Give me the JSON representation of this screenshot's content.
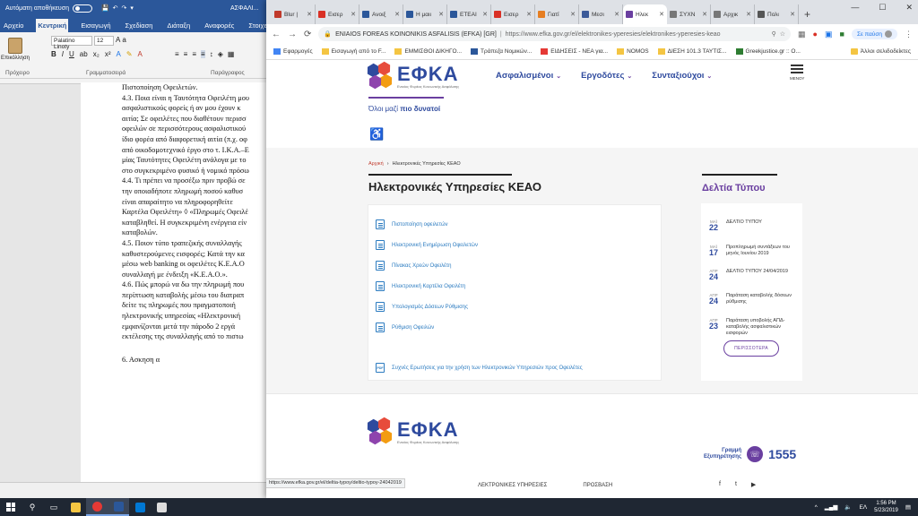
{
  "word": {
    "autosave_label": "Αυτόματη αποθήκευση",
    "doc_title": "ΑΣΦΑΛΙ...",
    "tabs": [
      "Αρχείο",
      "Κεντρική",
      "Εισαγωγή",
      "Σχεδίαση",
      "Διάταξη",
      "Αναφορές",
      "Στοιχεία αλληλ"
    ],
    "font_name": "Palatino Linoty",
    "font_size": "12",
    "paste_label": "Επικόλληση",
    "groups": [
      "Πρόχειρο",
      "Γραμματοσειρά",
      "Παράγραφος"
    ],
    "lines": [
      "Πιστοποίηση Οφειλετών.",
      "4.3. Ποια είναι η Ταυτότητα Οφειλέτη μου",
      "ασφαλιστικούς φορείς ή αν μου έχουν κ",
      "αιτία; Σε οφειλέτες που διαθέτουν περισσ",
      "οφειλών σε περισσότερους ασφαλιστικού",
      "ίδιο φορέα από διαφορετική αιτία (π.χ. οφ",
      "από οικοδομοτεχνικό έργο στο τ. Ι.Κ.Α.–Ε",
      "μίας Ταυτότητες Οφειλέτη ανάλογα με το",
      "στο συγκεκριμένο φυσικό ή νομικό πρόσω",
      "4.4. Τι πρέπει να προσέξω πριν προβώ σε",
      "την οποιαδήποτε πληρωμή ποσού καθυσ",
      "είναι απαραίτητο να πληροφορηθείτε",
      "Καρτέλα Οφειλέτη» ◊ «Πληρωμές Οφειλέ",
      "καταβληθεί. Η συγκεκριμένη ενέργεια είν",
      "καταβολών.",
      " 4.5. Ποιον τύπο τραπεζικής συναλλαγής",
      "καθυστερούμενες εισφορές; Κατά την κα",
      "μέσω web banking οι οφειλέτες Κ.Ε.Α.Ο",
      "συναλλαγή με ένδειξη «Κ.Ε.Α.Ο.».",
      "4.6. Πώς μπορώ να δω την πληρωμή που",
      "περίπτωση καταβολής μέσω του διατραπ",
      "δείτε τις πληρωμές που πραγματοποιή",
      "ηλεκτρονικής υπηρεσίας «Ηλεκτρονική",
      "εμφανίζονται μετά την πάροδο 2 εργά",
      "εκτέλεσης της συναλλαγής από το πιστω",
      "",
      "                          6. Ασκηση α"
    ]
  },
  "chrome": {
    "tabs": [
      {
        "label": "Blur |",
        "color": "#c0392b"
      },
      {
        "label": "Εισερ",
        "color": "#d93025"
      },
      {
        "label": "Ανοιξ",
        "color": "#2b579a"
      },
      {
        "label": "Η μαιι",
        "color": "#2b579a"
      },
      {
        "label": "ΕΤΕΑΙ",
        "color": "#2b579a"
      },
      {
        "label": "Εισερ",
        "color": "#d93025"
      },
      {
        "label": "Γιατί",
        "color": "#e67e22"
      },
      {
        "label": "Μεσι",
        "color": "#3b5998"
      },
      {
        "label": "Ηλεκ",
        "color": "#6a3fa0"
      },
      {
        "label": "ΣΥΧΝ",
        "color": "#777777"
      },
      {
        "label": "Αρχικ",
        "color": "#777777"
      },
      {
        "label": "Πολι",
        "color": "#555555"
      }
    ],
    "site_name": "ENIAIOS FOREAS KOINONIKIS ASFALISIS (EFKA) [GR]",
    "url": "https://www.efka.gov.gr/el/elektronikes-yperesies/elektronikes-yperesies-keao",
    "profile_label": "Σε παύση",
    "bookmarks": [
      {
        "label": "Εφαρμογές",
        "color": "#4285f4"
      },
      {
        "label": "Εισαγωγή από το F...",
        "color": "#f4c542"
      },
      {
        "label": "ΕΜΜΙΣΘΟΙ ΔΙΚΗΓΟ...",
        "color": "#f4c542"
      },
      {
        "label": "Τράπεζα Νομικών...",
        "color": "#2b579a"
      },
      {
        "label": "ΕΙΔΗΣΕΙΣ - ΝΕΑ για...",
        "color": "#e53935"
      },
      {
        "label": "NOMOS",
        "color": "#f4c542"
      },
      {
        "label": "ΔΙΕΣΗ 101.3 ΤΑΥΤΙΣ...",
        "color": "#f4c542"
      },
      {
        "label": "Greekjustice.gr :: Ο...",
        "color": "#2e7d32"
      }
    ],
    "other_bookmarks": "Άλλοι σελιδοδείκτες",
    "status_url": "https://www.efka.gov.gr/el/deltia-typoy/deltio-typoy-24042019"
  },
  "efka": {
    "logo_text": "ΕΦΚΑ",
    "logo_sub": "Ενιαίος Φορέας Κοινωνικής Ασφάλισης",
    "nav": [
      "Ασφαλισμένοι",
      "Εργοδότες",
      "Συνταξιούχοι"
    ],
    "menu_label": "ΜΕΝΟΥ",
    "slogan_prefix": "Όλοι μαζί",
    "slogan_bold": "πιο δυνατοί",
    "breadcrumb_home": "Αρχική",
    "breadcrumb_current": "Ηλεκτρονικές Υπηρεσίες ΚΕΑΟ",
    "page_title": "Ηλεκτρονικές Υπηρεσίες ΚΕΑΟ",
    "services": [
      "Πιστοποίηση οφειλετών",
      "Ηλεκτρονική Ενημέρωση Οφειλετών",
      "Πίνακας Χρεών Οφειλέτη",
      "Ηλεκτρονική Καρτέλα Οφειλέτη",
      "Υπολογισμός Δόσεων Ρύθμισης",
      "Ρύθμιση Οφειλών"
    ],
    "faq": "Συχνές Ερωτήσεις για την χρήση των Ηλεκτρονικών Υπηρεσιών προς Οφειλέτες",
    "pdf_label": "PDF",
    "press_title": "Δελτία Τύπου",
    "press": [
      {
        "month": "ΜΑΪ",
        "day": "22",
        "text": "ΔΕΛΤΙΟ ΤΥΠΟΥ"
      },
      {
        "month": "ΜΑΪ",
        "day": "17",
        "text": "Προπληρωμή συντάξεων του μηνός Ιουνίου 2019"
      },
      {
        "month": "ΑΠΡ",
        "day": "24",
        "text": "ΔΕΛΤΙΟ ΤΥΠΟΥ 24/04/2019"
      },
      {
        "month": "ΑΠΡ",
        "day": "24",
        "text": "Παράταση καταβολής δόσεων ρύθμισης"
      },
      {
        "month": "ΑΠΡ",
        "day": "23",
        "text": "Παράταση υποβολής ΑΠΔ-καταβολής ασφαλιστικών εισφορών"
      }
    ],
    "more_button": "ΠΕΡΙΣΣΟΤΕΡΑ",
    "helpline_label_1": "Γραμμή",
    "helpline_label_2": "Εξυπηρέτησης",
    "helpline_number": "1555",
    "footer_links": [
      "ΛΕΚΤΡΟΝΙΚΕΣ ΥΠΗΡΕΣΙΕΣ",
      "ΠΡΟΣΒΑΣΗ"
    ]
  },
  "taskbar": {
    "lang": "ΕΛ",
    "time": "1:56 PM",
    "date": "5/23/2019"
  }
}
